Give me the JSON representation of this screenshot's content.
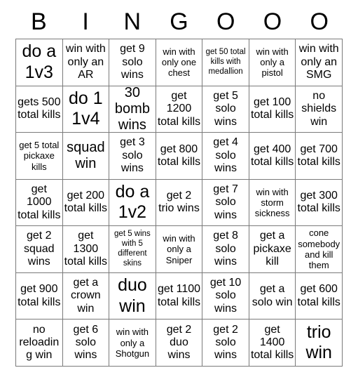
{
  "header": {
    "letters": [
      "B",
      "I",
      "N",
      "G",
      "O",
      "O",
      "O"
    ]
  },
  "grid": {
    "columns": 7,
    "rows": 7,
    "cells": [
      "do a 1v3",
      "win with only an AR",
      "get 9 solo wins",
      "win with only one chest",
      "get 50 total kills with medallion",
      "win with only a pistol",
      "win with only an SMG",
      "gets 500 total kills",
      "do 1 1v4",
      "30 bomb wins",
      "get 1200 total kills",
      "get 5 solo wins",
      "get 100 total kills",
      "no shields win",
      "get 5 total pickaxe kills",
      "squad win",
      "get 3 solo wins",
      "get 800 total kills",
      "get 4 solo wins",
      "get 400 total kills",
      "get 700 total kills",
      "get 1000 total kills",
      "get 200 total kills",
      "do a 1v2",
      "get 2 trio wins",
      "get 7 solo wins",
      "win with storm sickness",
      "get 300 total kills",
      "get 2 squad wins",
      "get 1300 total kills",
      "get 5 wins with 5 different skins",
      "win with only a Sniper",
      "get 8 solo wins",
      "get a pickaxe kill",
      "cone somebody and kill them",
      "get 900 total kills",
      "get a crown win",
      "duo win",
      "get 1100 total kills",
      "get 10 solo wins",
      "get a solo win",
      "get 600 total kills",
      "no reloading win",
      "get 6 solo wins",
      "win with only a Shotgun",
      "get 2 duo wins",
      "get 2 solo wins",
      "get 1400 total kills",
      "trio win"
    ]
  },
  "colors": {
    "background": "#ffffff",
    "grid_line": "#7a7a7a",
    "text": "#000000"
  }
}
